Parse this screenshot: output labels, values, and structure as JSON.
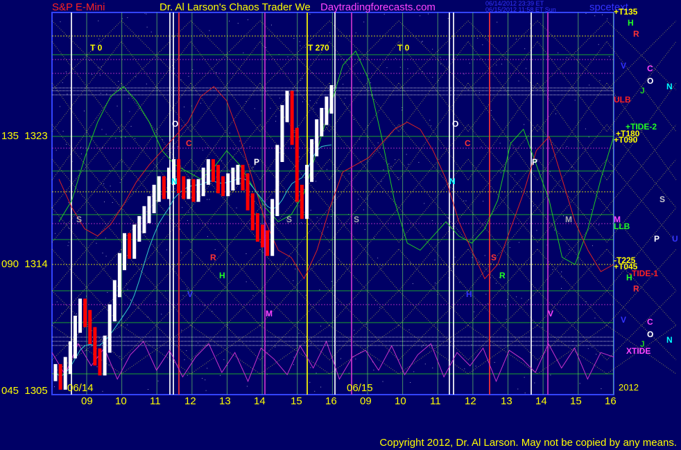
{
  "header": {
    "symbol": "S&P E-Mini",
    "title": "Dr. Al Larson's Chaos Trader We",
    "site": "Daytradingforecasts.com",
    "timestamp_1": "06/14/2012 23:39 ET",
    "timestamp_2": "06/15/2012 11:58 ET Sun",
    "right_title": "spcetext"
  },
  "colors": {
    "background": "#000066",
    "price_up": "#ffffff",
    "price_down": "#ff0000",
    "flux_green": "#22cc22",
    "flux_red": "#dd2222",
    "tide_magenta": "#cc33cc",
    "grid_yellow": "#ffff00",
    "vline_white": "#ffffff"
  },
  "y_axis_labels": [
    {
      "angle": "135",
      "price": "1323"
    },
    {
      "angle": "090",
      "price": "1314"
    },
    {
      "angle": "045",
      "price": "1305"
    }
  ],
  "x_axis": {
    "hours": [
      "09",
      "10",
      "11",
      "12",
      "13",
      "14",
      "15",
      "16",
      "09",
      "10",
      "11",
      "12",
      "13",
      "14",
      "15",
      "16"
    ],
    "dates": [
      "06/14",
      "06/15"
    ],
    "corner": "2012"
  },
  "top_markers": [
    "T 0",
    "T 270",
    "T 0"
  ],
  "right_labels": [
    "+T135",
    "H",
    "R",
    "V",
    "C",
    "O",
    "J",
    "N",
    "ULB",
    "+TIDE-2",
    "+T180",
    "+T090",
    "S",
    "M",
    "LLB",
    "P",
    "U",
    "-T225",
    "+T045",
    "-TIDE-1",
    "H",
    "R",
    "V",
    "C",
    "O",
    "N",
    "J",
    "XTIDE"
  ],
  "chart_markers": [
    "O",
    "C",
    "N",
    "P",
    "S",
    "S",
    "S",
    "R",
    "H",
    "V",
    "M",
    "O",
    "C",
    "N",
    "P",
    "S",
    "R",
    "H",
    "V",
    "M",
    "S"
  ],
  "copyright": "Copyright 2012, Dr. Al Larson. May not be copied by any means.",
  "chart_data": {
    "type": "line",
    "title": "S&P E-Mini",
    "ylim": [
      1305,
      1330
    ],
    "yticks": [
      1305,
      1314,
      1323
    ],
    "price_bars": [
      1306.4,
      1305.8,
      1306.9,
      1308.0,
      1309.8,
      1311.0,
      1310.2,
      1309.0,
      1307.5,
      1306.8,
      1308.4,
      1310.6,
      1312.3,
      1314.2,
      1315.6,
      1315.0,
      1316.2,
      1316.8,
      1317.5,
      1318.2,
      1319.0,
      1319.6,
      1319.2,
      1320.2,
      1320.8,
      1319.6,
      1319.2,
      1319.4,
      1319.0,
      1319.4,
      1320.2,
      1320.8,
      1320.4,
      1319.6,
      1319.4,
      1319.8,
      1320.2,
      1320.4,
      1319.8,
      1318.4,
      1317.0,
      1316.2,
      1315.8,
      1315.2,
      1318.0,
      1321.8,
      1324.6,
      1325.6,
      1323.0,
      1319.0,
      1317.8,
      1320.4,
      1322.2,
      1323.6,
      1324.4,
      1325.2,
      1326.0
    ],
    "series": [
      {
        "name": "flux-green",
        "values": [
          1317.0,
          1318.5,
          1321.5,
          1324.0,
          1325.8,
          1326.5,
          1325.5,
          1324.0,
          1322.0,
          1321.0,
          1320.5,
          1320.0,
          1320.8,
          1322.0,
          1321.0,
          1319.5,
          1318.0,
          1317.0,
          1317.5,
          1319.0,
          1322.0,
          1325.0,
          1328.0,
          1329.0,
          1327.0,
          1323.0,
          1318.5,
          1315.5,
          1315.0,
          1316.0,
          1317.0,
          1316.0,
          1315.5,
          1316.5,
          1318.5,
          1322.5,
          1323.5,
          1321.0,
          1318.5,
          1314.5,
          1314.0,
          1316.5,
          1320.0,
          1323.0
        ]
      },
      {
        "name": "flux-red",
        "values": [
          1320.0,
          1318.0,
          1316.5,
          1316.0,
          1316.8,
          1318.2,
          1319.8,
          1321.0,
          1322.0,
          1323.0,
          1324.0,
          1325.8,
          1326.5,
          1325.5,
          1323.0,
          1320.0,
          1317.0,
          1315.0,
          1314.5,
          1313.0,
          1315.0,
          1318.0,
          1320.5,
          1321.0,
          1321.5,
          1322.5,
          1323.5,
          1324.0,
          1323.5,
          1322.0,
          1320.0,
          1317.0,
          1315.0,
          1313.0,
          1314.0,
          1316.5,
          1319.0,
          1322.0,
          1323.0,
          1320.0,
          1317.0,
          1315.0,
          1313.5,
          1314.0
        ]
      },
      {
        "name": "xtide",
        "values": [
          0.4,
          -0.6,
          0.8,
          -0.2,
          0.6,
          -0.8,
          0.3,
          0.9,
          -0.4,
          0.5,
          -0.7,
          0.2,
          0.8,
          -0.5,
          0.4,
          -0.9,
          0.6,
          0.1,
          -0.6,
          0.7,
          -0.3,
          0.9,
          -0.8,
          0.2,
          0.5,
          -0.4,
          0.7,
          -0.6,
          0.3,
          0.8,
          -0.7,
          0.4,
          -0.2,
          0.6,
          -0.9,
          0.5,
          0.1,
          -0.5,
          0.8,
          -0.3,
          0.6,
          -0.8,
          0.4,
          0.2
        ]
      }
    ]
  }
}
